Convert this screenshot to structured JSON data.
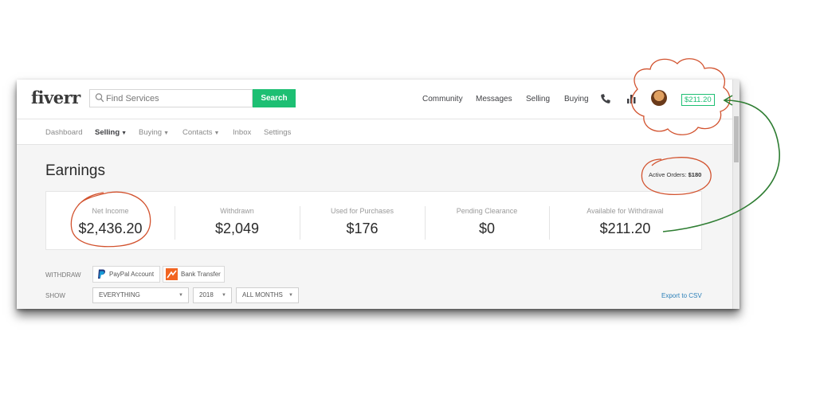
{
  "header": {
    "logo": "fiverr",
    "search_placeholder": "Find Services",
    "search_button": "Search",
    "nav": [
      "Community",
      "Messages",
      "Selling",
      "Buying"
    ],
    "balance": "$211.20"
  },
  "subnav": {
    "dashboard": "Dashboard",
    "selling": "Selling",
    "buying": "Buying",
    "contacts": "Contacts",
    "inbox": "Inbox",
    "settings": "Settings"
  },
  "page": {
    "title": "Earnings",
    "active_orders_label": "Active Orders:",
    "active_orders_value": "$180"
  },
  "stats": [
    {
      "label": "Net Income",
      "value": "$2,436.20"
    },
    {
      "label": "Withdrawn",
      "value": "$2,049"
    },
    {
      "label": "Used for Purchases",
      "value": "$176"
    },
    {
      "label": "Pending Clearance",
      "value": "$0"
    },
    {
      "label": "Available for Withdrawal",
      "value": "$211.20"
    }
  ],
  "withdraw": {
    "label": "WITHDRAW",
    "paypal": "PayPal Account",
    "bank": "Bank Transfer"
  },
  "filters": {
    "label": "SHOW",
    "type": "EVERYTHING",
    "year": "2018",
    "months": "ALL MONTHS",
    "export": "Export to CSV"
  },
  "colors": {
    "brand_green": "#1dbf73",
    "annotation_red": "#d2522e",
    "annotation_green": "#2e7d32",
    "link_blue": "#2a7fb8"
  }
}
